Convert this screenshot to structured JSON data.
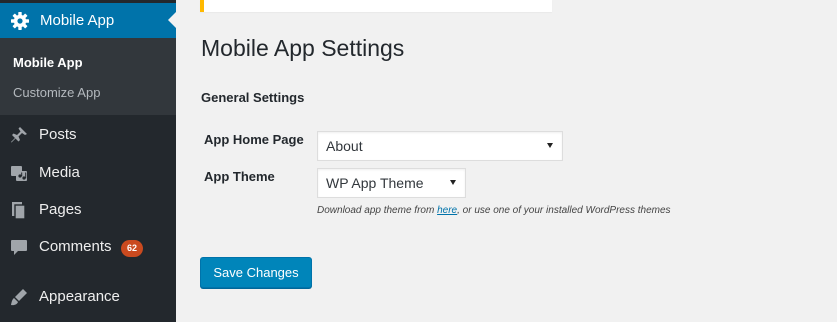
{
  "sidebar": {
    "current": {
      "label": "Mobile App",
      "icon": "gear-icon"
    },
    "submenu": [
      {
        "label": "Mobile App",
        "active": true
      },
      {
        "label": "Customize App",
        "active": false
      }
    ],
    "items": [
      {
        "label": "Posts",
        "icon": "pushpin-icon"
      },
      {
        "label": "Media",
        "icon": "media-icon"
      },
      {
        "label": "Pages",
        "icon": "pages-icon"
      },
      {
        "label": "Comments",
        "icon": "comment-bubble-icon",
        "badge": "62"
      },
      {
        "label": "Appearance",
        "icon": "paintbrush-icon"
      }
    ]
  },
  "main": {
    "title": "Mobile App Settings",
    "section_title": "General Settings",
    "fields": {
      "home_page": {
        "label": "App Home Page",
        "value": "About"
      },
      "theme": {
        "label": "App Theme",
        "value": "WP App Theme"
      }
    },
    "description": {
      "prefix": "Download app theme from ",
      "link": "here",
      "suffix": ", or use one of your installed WordPress themes"
    },
    "save_label": "Save Changes"
  },
  "colors": {
    "sidebar_bg": "#23282d",
    "submenu_bg": "#32373c",
    "accent": "#0073aa",
    "button": "#0085ba",
    "badge": "#ca4a1f",
    "notice_border": "#ffb900"
  }
}
